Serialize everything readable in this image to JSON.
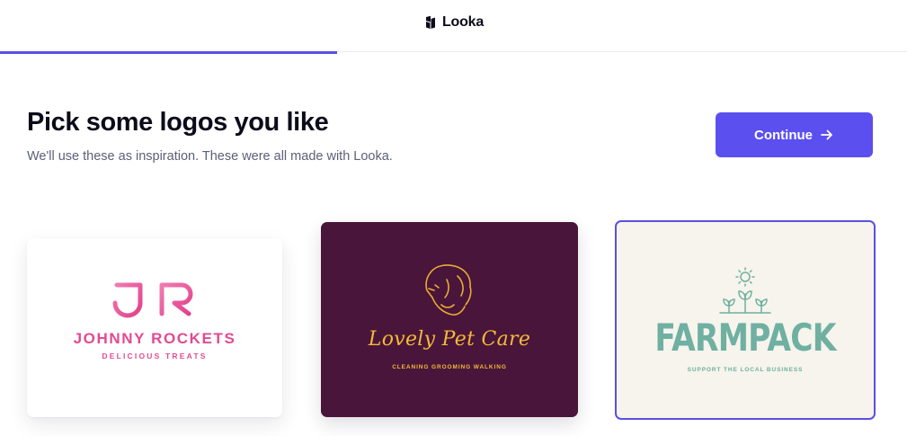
{
  "header": {
    "brand_name": "Looka",
    "progress_fraction": 0.37
  },
  "main": {
    "title": "Pick some logos you like",
    "subtitle": "We'll use these as inspiration. These were all made with Looka.",
    "continue_label": "Continue"
  },
  "logos": [
    {
      "monogram": "JR",
      "name": "JOHNNY ROCKETS",
      "tagline": "DELICIOUS TREATS",
      "background": "#ffffff",
      "accent": "#e24a92",
      "selected": false
    },
    {
      "name": "Lovely Pet Care",
      "tagline": "CLEANING  GROOMING  WALKING",
      "background": "#4a153a",
      "accent": "#f2b93b",
      "icon": "dog-face-icon",
      "selected": false
    },
    {
      "name": "FARMPACK",
      "tagline": "SUPPORT THE LOCAL BUSINESS",
      "background": "#f6f4ec",
      "accent": "#6fb0a2",
      "icon": "sun-sprouts-icon",
      "selected": true
    }
  ],
  "colors": {
    "accent": "#5b4fe0",
    "button": "#5b4ff0"
  }
}
